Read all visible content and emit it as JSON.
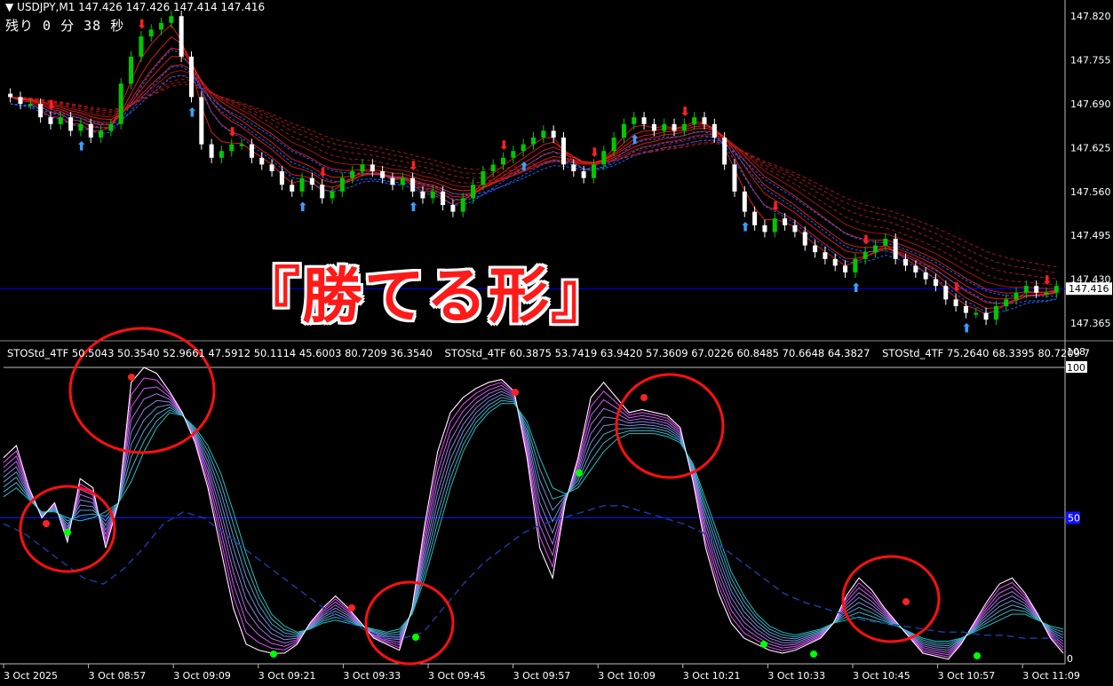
{
  "header": {
    "symbol_line": "USDJPY,M1  147.426 147.426 147.414 147.416",
    "countdown": "残り 0 分 38 秒"
  },
  "indicator": {
    "labels": [
      "STOStd_4TF 50.5043 50.3540 52.9661 47.5912 50.1114 45.6003 80.7209 36.3540",
      "STOStd_4TF 60.3875 53.7419 63.9420 57.3609 67.0226 60.8485 70.6648 64.3827",
      "STOStd_4TF 75.2640 68.3395 80.7209 7"
    ]
  },
  "slogan": "『勝てる形』",
  "colors": {
    "bull": "#00c800",
    "bear": "#ffffff",
    "ribbon_hot": "#ff2020",
    "ribbon_cool": "#2060ff",
    "stoch_hot": "#ff40ff",
    "stoch_cool": "#20c0c0",
    "signal_red": "#ff2020",
    "signal_green": "#00ff00",
    "level": "#1010ff",
    "highlight": "#0000ff"
  },
  "chart_data": [
    {
      "type": "candlestick",
      "symbol": "USDJPY",
      "timeframe": "M1",
      "y_ticks": [
        "147.820",
        "147.755",
        "147.690",
        "147.625",
        "147.560",
        "147.495",
        "147.430",
        "147.365"
      ],
      "ylim": [
        147.34,
        147.84
      ],
      "current_price": "147.416",
      "close": [
        147.7,
        147.69,
        147.69,
        147.67,
        147.66,
        147.67,
        147.65,
        147.66,
        147.64,
        147.65,
        147.66,
        147.72,
        147.76,
        147.79,
        147.8,
        147.81,
        147.82,
        147.76,
        147.7,
        147.63,
        147.61,
        147.62,
        147.63,
        147.63,
        147.61,
        147.6,
        147.59,
        147.57,
        147.56,
        147.58,
        147.57,
        147.55,
        147.56,
        147.58,
        147.59,
        147.6,
        147.59,
        147.58,
        147.57,
        147.58,
        147.56,
        147.55,
        147.56,
        147.54,
        147.53,
        147.55,
        147.57,
        147.59,
        147.6,
        147.61,
        147.62,
        147.63,
        147.64,
        147.65,
        147.64,
        147.6,
        147.59,
        147.58,
        147.6,
        147.62,
        147.64,
        147.66,
        147.67,
        147.66,
        147.65,
        147.66,
        147.65,
        147.66,
        147.67,
        147.66,
        147.64,
        147.6,
        147.56,
        147.53,
        147.51,
        147.5,
        147.52,
        147.51,
        147.5,
        147.48,
        147.47,
        147.46,
        147.45,
        147.44,
        147.46,
        147.47,
        147.48,
        147.49,
        147.46,
        147.45,
        147.44,
        147.43,
        147.42,
        147.4,
        147.39,
        147.38,
        147.38,
        147.37,
        147.39,
        147.4,
        147.41,
        147.42,
        147.41,
        147.41,
        147.42
      ],
      "x_ticks": [
        "3 Oct 2025",
        "3 Oct 08:57",
        "3 Oct 09:09",
        "3 Oct 09:21",
        "3 Oct 09:33",
        "3 Oct 09:45",
        "3 Oct 09:57",
        "3 Oct 10:09",
        "3 Oct 10:21",
        "3 Oct 10:33",
        "3 Oct 10:45",
        "3 Oct 10:57",
        "3 Oct 11:09"
      ]
    },
    {
      "type": "line",
      "name": "STOStd_4TF",
      "ylim": [
        0,
        100
      ],
      "y_ticks": [
        "108",
        "100",
        "50",
        "0"
      ],
      "level": 50,
      "series": [
        {
          "name": "fast",
          "values": [
            70,
            74,
            60,
            50,
            55,
            42,
            63,
            60,
            40,
            55,
            95,
            100,
            98,
            92,
            85,
            75,
            60,
            40,
            20,
            8,
            6,
            5,
            5,
            8,
            15,
            20,
            24,
            20,
            15,
            10,
            8,
            6,
            20,
            48,
            72,
            85,
            90,
            93,
            95,
            96,
            92,
            70,
            40,
            30,
            55,
            70,
            90,
            95,
            90,
            85,
            86,
            85,
            84,
            80,
            62,
            40,
            25,
            15,
            10,
            8,
            6,
            5,
            6,
            8,
            10,
            15,
            24,
            30,
            26,
            20,
            15,
            10,
            5,
            4,
            3,
            8,
            15,
            22,
            28,
            30,
            25,
            18,
            10,
            5
          ]
        },
        {
          "name": "mid",
          "values": [
            62,
            66,
            58,
            50,
            52,
            45,
            50,
            52,
            48,
            55,
            75,
            92,
            95,
            94,
            88,
            80,
            70,
            55,
            35,
            20,
            12,
            8,
            8,
            10,
            14,
            18,
            20,
            18,
            15,
            12,
            10,
            10,
            18,
            40,
            62,
            78,
            86,
            90,
            92,
            93,
            90,
            78,
            58,
            45,
            55,
            62,
            75,
            82,
            84,
            84,
            84,
            83,
            82,
            78,
            65,
            48,
            32,
            22,
            15,
            10,
            8,
            7,
            8,
            10,
            12,
            16,
            20,
            22,
            20,
            18,
            14,
            10,
            8,
            6,
            6,
            8,
            12,
            16,
            20,
            22,
            20,
            16,
            12,
            10
          ]
        },
        {
          "name": "slow",
          "values": [
            57,
            60,
            56,
            52,
            52,
            50,
            49,
            50,
            52,
            55,
            62,
            72,
            80,
            85,
            84,
            80,
            74,
            65,
            52,
            38,
            26,
            18,
            14,
            12,
            13,
            15,
            16,
            15,
            14,
            13,
            12,
            13,
            18,
            30,
            45,
            60,
            72,
            80,
            85,
            88,
            88,
            82,
            70,
            60,
            58,
            60,
            66,
            72,
            76,
            78,
            78,
            78,
            77,
            75,
            68,
            56,
            44,
            32,
            24,
            18,
            14,
            12,
            11,
            12,
            13,
            15,
            16,
            17,
            16,
            15,
            14,
            12,
            10,
            9,
            9,
            10,
            12,
            14,
            16,
            18,
            18,
            16,
            14,
            13
          ]
        },
        {
          "name": "trend",
          "values": [
            48,
            45,
            40,
            35,
            30,
            28,
            33,
            40,
            48,
            52,
            50,
            45,
            40,
            35,
            30,
            25,
            20,
            16,
            13,
            10,
            10,
            12,
            20,
            28,
            35,
            40,
            45,
            48,
            50,
            52,
            54,
            54,
            52,
            50,
            48,
            45,
            40,
            35,
            30,
            25,
            22,
            20,
            18,
            16,
            15,
            14,
            13,
            12,
            12,
            11,
            11,
            10,
            10,
            10
          ]
        }
      ],
      "x_ticks": [
        "3 Oct 2025",
        "3 Oct 08:57",
        "3 Oct 09:09",
        "3 Oct 09:21",
        "3 Oct 09:33",
        "3 Oct 09:45",
        "3 Oct 09:57",
        "3 Oct 10:09",
        "3 Oct 10:21",
        "3 Oct 10:33",
        "3 Oct 10:45",
        "3 Oct 10:57",
        "3 Oct 11:09"
      ]
    }
  ]
}
